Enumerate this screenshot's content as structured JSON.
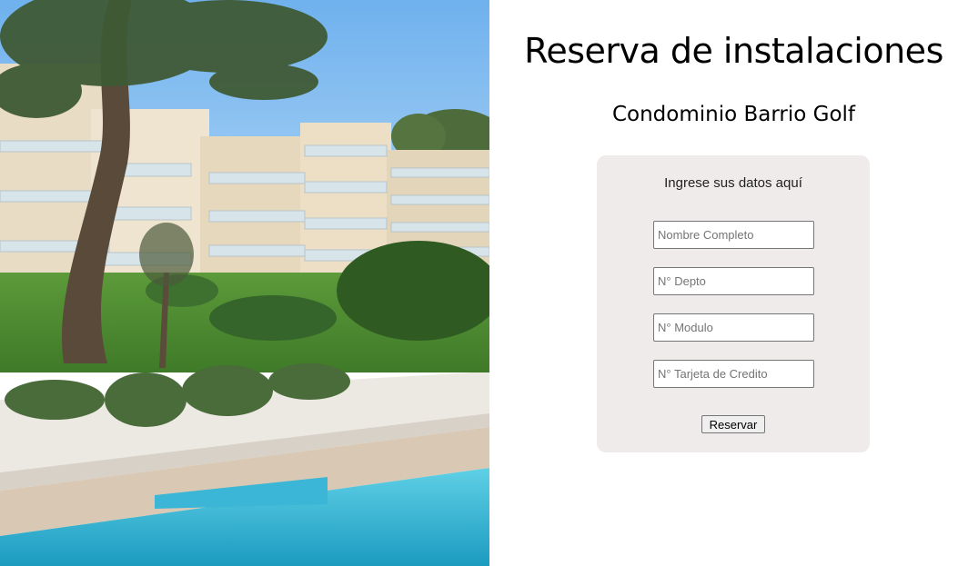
{
  "photo": {
    "description_icon": "condominium-pool-photo"
  },
  "header": {
    "title": "Reserva de instalaciones",
    "subtitle": "Condominio Barrio Golf"
  },
  "form": {
    "heading": "Ingrese sus datos aquí",
    "fields": [
      {
        "placeholder": "Nombre Completo",
        "value": ""
      },
      {
        "placeholder": "N° Depto",
        "value": ""
      },
      {
        "placeholder": "N° Modulo",
        "value": ""
      },
      {
        "placeholder": "N° Tarjeta de Credito",
        "value": ""
      }
    ],
    "submit_label": "Reservar"
  },
  "colors": {
    "card_background": "#efebea",
    "page_background": "#ffffff"
  }
}
